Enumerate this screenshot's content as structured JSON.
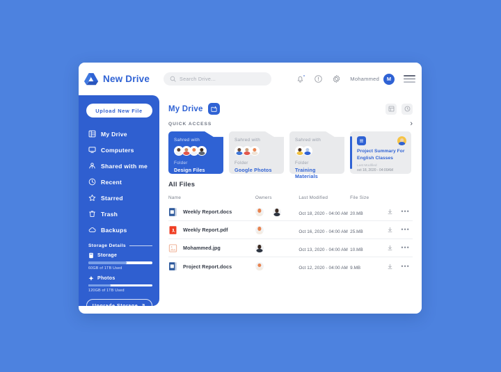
{
  "brand": {
    "name": "New Drive",
    "logo_icon": "drive-logo-icon"
  },
  "search": {
    "placeholder": "Search Drive...",
    "icon": "search-icon"
  },
  "topbar": {
    "notifications_icon": "bell-icon",
    "help_icon": "help-circle-icon",
    "settings_icon": "gear-icon",
    "user_name": "Mohammed",
    "user_initial": "M",
    "menu_icon": "hamburger-menu-icon"
  },
  "sidebar": {
    "upload_label": "Upload New File",
    "items": [
      {
        "label": "My Drive",
        "icon": "drive-grid-icon"
      },
      {
        "label": "Computers",
        "icon": "monitor-icon"
      },
      {
        "label": "Shared with me",
        "icon": "shared-people-icon"
      },
      {
        "label": "Recent",
        "icon": "clock-icon"
      },
      {
        "label": "Starred",
        "icon": "star-icon"
      },
      {
        "label": "Trash",
        "icon": "trash-icon"
      },
      {
        "label": "Backups",
        "icon": "cloud-icon"
      }
    ],
    "storage_details_label": "Storage Details",
    "meters": [
      {
        "label": "Storage",
        "icon": "storage-drive-icon",
        "caption": "60GB of 1TB Used",
        "percent": 60
      },
      {
        "label": "Photos",
        "icon": "photos-icon",
        "caption": "120GB of 1TB Used",
        "percent": 35
      }
    ],
    "upgrade_label": "Upgrade Storage",
    "upgrade_icon": "arrow-up-right-icon"
  },
  "main": {
    "page_title": "My Drive",
    "new_folder_icon": "folder-add-icon",
    "view_grid_icon": "grid-view-icon",
    "view_recent_icon": "clock-view-icon",
    "quick_access_label": "QUICK ACCESS",
    "carousel_next_icon": "chevron-right-icon",
    "cards": [
      {
        "type": "folder",
        "shared_label": "Sahred with",
        "kind": "Folder",
        "name": "Design Files",
        "active": true,
        "avatars": 4
      },
      {
        "type": "folder",
        "shared_label": "Sahred with",
        "kind": "Folder",
        "name": "Google Photos",
        "active": false,
        "avatars": 3
      },
      {
        "type": "folder",
        "shared_label": "Sahred with",
        "kind": "Folder",
        "name": "Training  Materials",
        "active": false,
        "avatars": 2
      },
      {
        "type": "doc",
        "badge_icon": "document-lines-icon",
        "title_line1": "Project Summary For",
        "title_line2": "English Classes",
        "meta_label": "Last Modified",
        "meta_date": "oct 18, 2020 - 04:00AM"
      }
    ],
    "files_title": "All Files",
    "columns": [
      "Name",
      "Owners",
      "Last Modified",
      "File Size"
    ],
    "rows": [
      {
        "name": "Weekly Report.docs",
        "icon": "word-document-icon",
        "owners": 2,
        "modified": "Oct 18, 2020 - 04:00 AM",
        "size": "20.MB",
        "download_icon": "download-icon",
        "more_icon": "more-options-icon"
      },
      {
        "name": "Weekly Report.pdf",
        "icon": "pdf-document-icon",
        "owners": 1,
        "modified": "Oct 16, 2020 - 04:00 AM",
        "size": "25.MB",
        "download_icon": "download-icon",
        "more_icon": "more-options-icon"
      },
      {
        "name": "Mohammed.jpg",
        "icon": "image-file-icon",
        "owners": 1,
        "modified": "Oct 13, 2020 - 04:00 AM",
        "size": "10.MB",
        "download_icon": "download-icon",
        "more_icon": "more-options-icon"
      },
      {
        "name": "Project Report.docs",
        "icon": "word-document-icon",
        "owners": 1,
        "modified": "Oct 12, 2020 - 04:00 AM",
        "size": "9.MB",
        "download_icon": "download-icon",
        "more_icon": "more-options-icon"
      }
    ]
  },
  "colors": {
    "page_background": "#4d82df",
    "sidebar": "#2f5fd0",
    "accent": "#2f62d4",
    "card_grey": "#e9eaec"
  }
}
